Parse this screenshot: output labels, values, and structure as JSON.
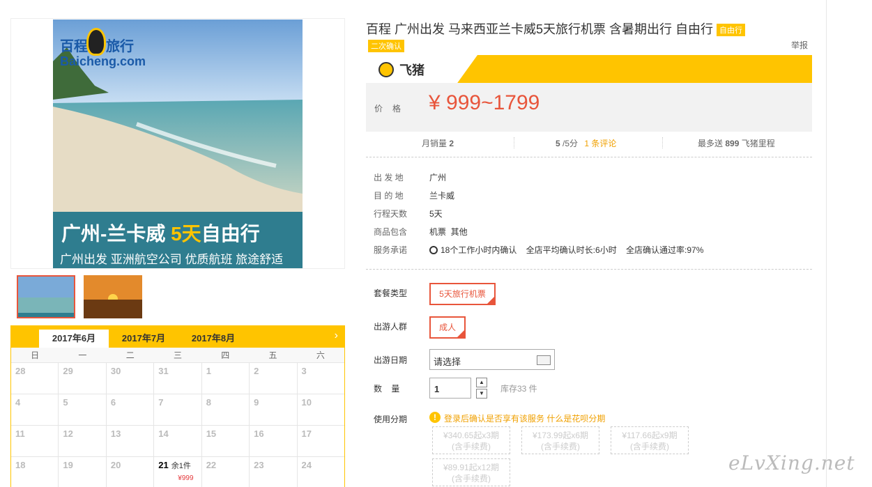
{
  "product": {
    "title": "百程 广州出发 马来西亚兰卡威5天旅行机票 含暑期出行 自由行",
    "title_tag": "自由行",
    "confirm_tag": "二次确认",
    "report_label": "举报"
  },
  "main_image": {
    "brand_cn": "百程",
    "brand_cn2": "旅行",
    "brand_en": "Baicheng.com",
    "banner_route": "广州-兰卡威",
    "banner_days": "5天",
    "banner_type": "自由行",
    "banner_sub": "广州出发 亚洲航空公司 优质航班 旅途舒适"
  },
  "calendar": {
    "tabs": [
      "2017年6月",
      "2017年7月",
      "2017年8月"
    ],
    "next_label": "›",
    "weekdays": [
      "日",
      "一",
      "二",
      "三",
      "四",
      "五",
      "六"
    ],
    "rows": [
      [
        "28",
        "29",
        "30",
        "31",
        "1",
        "2",
        "3"
      ],
      [
        "4",
        "5",
        "6",
        "7",
        "8",
        "9",
        "10"
      ],
      [
        "11",
        "12",
        "13",
        "14",
        "15",
        "16",
        "17"
      ],
      [
        "18",
        "19",
        "20",
        "21",
        "22",
        "23",
        "24"
      ]
    ],
    "available_day": {
      "day": "21",
      "remain": "余1件",
      "price": "¥999"
    }
  },
  "price": {
    "logo_text": "飞猪",
    "label": "价格",
    "value": "¥ 999~1799"
  },
  "stats": {
    "monthly_sales_label": "月销量",
    "monthly_sales": "2",
    "rating": "5",
    "rating_suffix": "/5分",
    "reviews": "1 条评论",
    "miles_prefix": "最多送",
    "miles": "899",
    "miles_suffix": "飞猪里程"
  },
  "info": [
    {
      "label": "出 发 地",
      "value": "广州"
    },
    {
      "label": "目 的 地",
      "value": "兰卡威"
    },
    {
      "label": "行程天数",
      "value": "5天"
    },
    {
      "label": "商品包含",
      "value": "机票  其他"
    },
    {
      "label": "服务承诺",
      "value": "18个工作小时内确认    全店平均确认时长:6小时    全店确认通过率:97%"
    }
  ],
  "options": {
    "package_label": "套餐类型",
    "package_value": "5天旅行机票",
    "group_label": "出游人群",
    "group_value": "成人",
    "date_label": "出游日期",
    "date_placeholder": "请选择",
    "qty_label": "数    量",
    "qty_value": "1",
    "stock": "库存33 件",
    "installment_label": "使用分期",
    "installment_note": "登录后确认是否享有该服务",
    "installment_link": "什么是花呗分期",
    "installments": [
      {
        "amount": "¥340.65起x3期",
        "fee": "(含手续费)"
      },
      {
        "amount": "¥173.99起x6期",
        "fee": "(含手续费)"
      },
      {
        "amount": "¥117.66起x9期",
        "fee": "(含手续费)"
      },
      {
        "amount": "¥89.91起x12期",
        "fee": "(含手续费)"
      }
    ]
  },
  "watermark": "eLvXing.net",
  "colors": {
    "accent": "#ffc400",
    "price": "#e8553b",
    "selected": "#e8553b"
  }
}
